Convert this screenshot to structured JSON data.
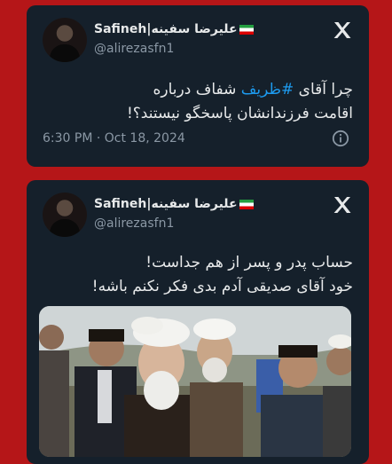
{
  "tweets": [
    {
      "display_name": "Safineh|علیرضا سفینه",
      "handle": "@alirezasfn1",
      "text_before": "چرا آقای ",
      "hashtag": "#ظریف",
      "text_after": " شفاف درباره",
      "text_line2": "اقامت فرزندانشان پاسخگو نیستند؟!",
      "time": "6:30 PM · Oct 18, 2024"
    },
    {
      "display_name": "Safineh|علیرضا سفینه",
      "handle": "@alirezasfn1",
      "text_line1": "حساب پدر و پسر از هم جداست!",
      "text_line2": "خود آقای صدیقی آدم بدی فکر نکنم باشه!"
    }
  ],
  "icons": {
    "brand": "x-logo-icon",
    "info": "info-icon",
    "flag": "iran-flag-icon"
  },
  "colors": {
    "background": "#b51618",
    "card": "#15202b",
    "hashtag": "#1d9bf0",
    "secondary_text": "#8b98a5"
  }
}
